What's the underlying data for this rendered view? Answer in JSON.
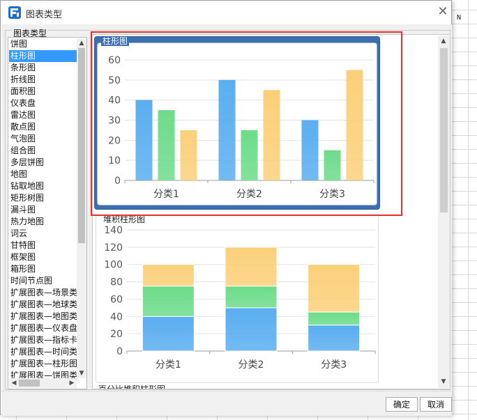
{
  "background": {
    "column_label": "N"
  },
  "dialog": {
    "title": "图表类型",
    "close_symbol": "✕",
    "group_label": "图表类型",
    "accent_color": "#3399ff",
    "highlight_color": "#e8302a"
  },
  "type_list": {
    "selected_index": 1,
    "items": [
      "饼图",
      "柱形图",
      "条形图",
      "折线图",
      "面积图",
      "仪表盘",
      "雷达图",
      "散点图",
      "气泡图",
      "组合图",
      "多层饼图",
      "地图",
      "钻取地图",
      "矩形树图",
      "漏斗图",
      "热力地图",
      "词云",
      "甘特图",
      "框架图",
      "箱形图",
      "时间节点图",
      "扩展图表—场景类",
      "扩展图表—地球类",
      "扩展图表—地图类",
      "扩展图表—仪表盘",
      "扩展图表—指标卡",
      "扩展图表—时间类",
      "扩展图表—柱形图",
      "扩展图表—饼图类"
    ]
  },
  "preview": {
    "cards": [
      {
        "title": "柱形图",
        "selected": true
      },
      {
        "title": "堆积柱形图",
        "selected": false
      }
    ],
    "next_card_title": "百分比堆积柱形图"
  },
  "chart_data": [
    {
      "type": "bar",
      "title": "柱形图",
      "categories": [
        "分类1",
        "分类2",
        "分类3"
      ],
      "series": [
        {
          "values": [
            40,
            50,
            30
          ],
          "color": "#5aaef0"
        },
        {
          "values": [
            35,
            25,
            15
          ],
          "color": "#6ddc8a"
        },
        {
          "values": [
            25,
            45,
            55
          ],
          "color": "#fbd07a"
        }
      ],
      "ylim": [
        0,
        60
      ],
      "yticks": [
        0,
        10,
        20,
        30,
        40,
        50,
        60
      ],
      "grid": true
    },
    {
      "type": "bar",
      "stacked": true,
      "title": "堆积柱形图",
      "categories": [
        "分类1",
        "分类2",
        "分类3"
      ],
      "series": [
        {
          "values": [
            40,
            50,
            30
          ],
          "color": "#5aaef0"
        },
        {
          "values": [
            35,
            25,
            15
          ],
          "color": "#6ddc8a"
        },
        {
          "values": [
            25,
            45,
            55
          ],
          "color": "#fbd07a"
        }
      ],
      "ylim": [
        0,
        140
      ],
      "yticks": [
        0,
        20,
        40,
        60,
        80,
        100,
        120,
        140
      ],
      "grid": true
    }
  ],
  "footer": {
    "ok_label": "确定",
    "cancel_label": "取消"
  }
}
